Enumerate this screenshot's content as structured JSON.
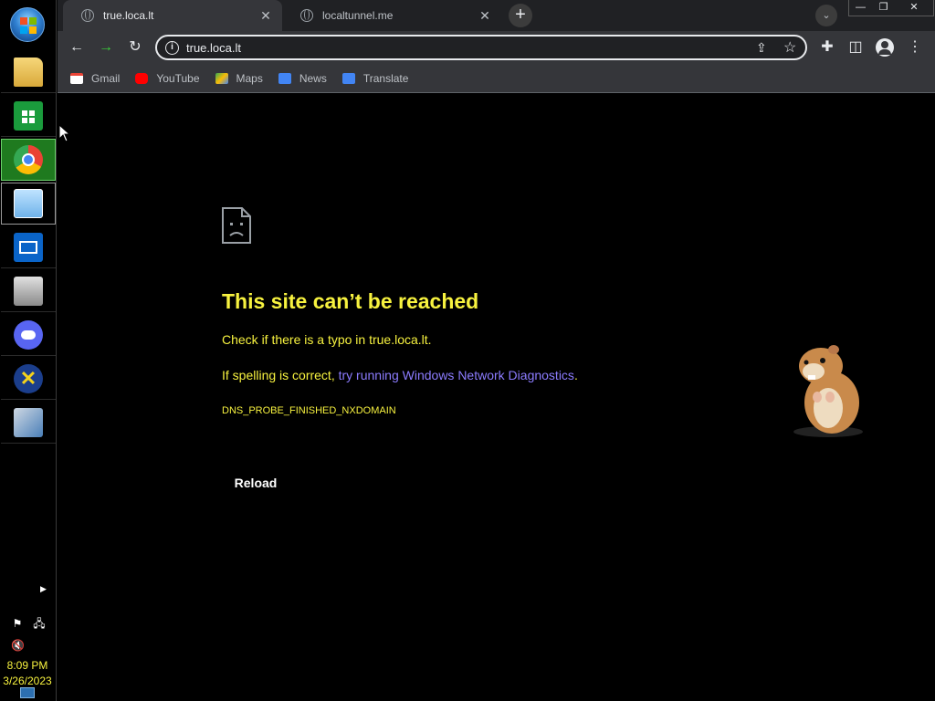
{
  "taskbar": {
    "items": [
      {
        "name": "file-explorer",
        "icon": "folder-icon"
      },
      {
        "name": "store",
        "icon": "store-icon"
      },
      {
        "name": "chrome",
        "icon": "chrome-icon"
      },
      {
        "name": "notepad",
        "icon": "notepad-icon"
      },
      {
        "name": "mail",
        "icon": "mail-icon"
      },
      {
        "name": "tool",
        "icon": "printer-icon"
      },
      {
        "name": "discord",
        "icon": "discord-icon"
      },
      {
        "name": "xampp",
        "icon": "x-icon"
      },
      {
        "name": "app",
        "icon": "app-icon"
      }
    ],
    "clock": {
      "time": "8:09 PM",
      "date": "3/26/2023"
    }
  },
  "browser": {
    "tabs": [
      {
        "label": "true.loca.lt",
        "active": true
      },
      {
        "label": "localtunnel.me",
        "active": false
      }
    ],
    "url": "true.loca.lt",
    "bookmarks": [
      {
        "label": "Gmail",
        "icon": "gmail-icon",
        "color": "#ea4335"
      },
      {
        "label": "YouTube",
        "icon": "youtube-icon",
        "color": "#ff0000"
      },
      {
        "label": "Maps",
        "icon": "maps-icon",
        "color": "#34a853"
      },
      {
        "label": "News",
        "icon": "news-icon",
        "color": "#4285f4"
      },
      {
        "label": "Translate",
        "icon": "translate-icon",
        "color": "#4285f4"
      }
    ]
  },
  "error_page": {
    "title": "This site can’t be reached",
    "line1": "Check if there is a typo in true.loca.lt.",
    "line2_prefix": "If spelling is correct, ",
    "line2_link": "try running Windows Network Diagnostics",
    "line2_suffix": ".",
    "code": "DNS_PROBE_FINISHED_NXDOMAIN",
    "reload_label": "Reload"
  },
  "colors": {
    "text_yellow": "#f7f23f",
    "link_purple": "#8c7cff",
    "chrome_dark": "#35363a"
  }
}
